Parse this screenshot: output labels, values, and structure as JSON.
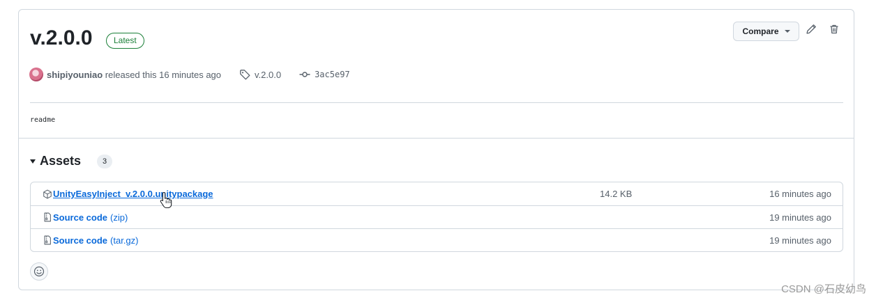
{
  "release": {
    "title": "v.2.0.0",
    "latest_badge": "Latest",
    "author": "shipiyouniao",
    "released_text": "released this 16 minutes ago",
    "tag": "v.2.0.0",
    "commit": "3ac5e97",
    "body": "readme"
  },
  "toolbar": {
    "compare_label": "Compare",
    "edit_icon": "pencil-icon",
    "delete_icon": "trash-icon"
  },
  "assets": {
    "title": "Assets",
    "count": "3",
    "items": [
      {
        "name": "UnityEasyInject_v.2.0.0.unitypackage",
        "suffix": "",
        "size": "14.2 KB",
        "time": "16 minutes ago",
        "icon": "package-icon"
      },
      {
        "name": "Source code",
        "suffix": "(zip)",
        "size": "",
        "time": "19 minutes ago",
        "icon": "file-zip-icon"
      },
      {
        "name": "Source code",
        "suffix": "(tar.gz)",
        "size": "",
        "time": "19 minutes ago",
        "icon": "file-zip-icon"
      }
    ]
  },
  "watermark": "CSDN @石皮幼鸟",
  "colors": {
    "link": "#0969da",
    "latest_green": "#1a7f37",
    "muted": "#57606a",
    "border": "#d0d7de"
  }
}
